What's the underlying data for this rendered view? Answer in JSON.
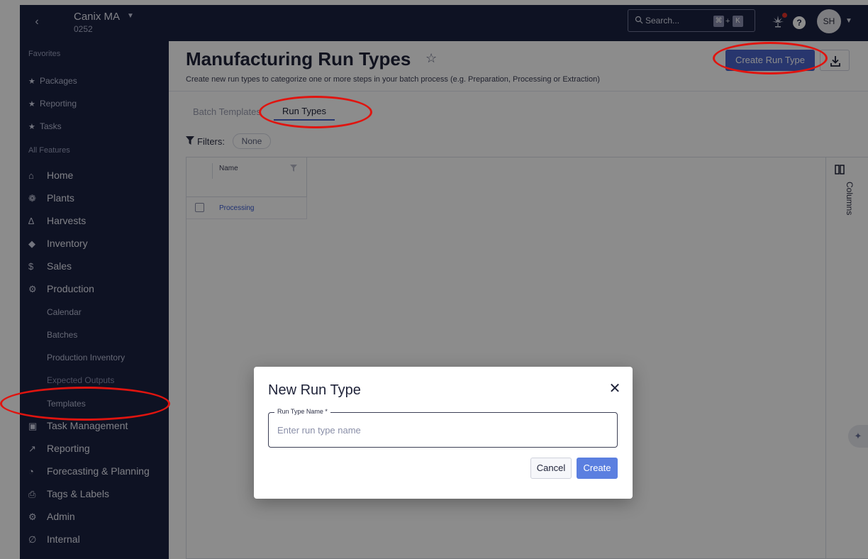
{
  "topbar": {
    "back_icon": "chevron-left-icon",
    "org_name": "Canix MA",
    "org_code": "0252",
    "search_placeholder": "Search...",
    "search_shortcut_cmd": "⌘",
    "search_shortcut_plus": "+",
    "search_shortcut_key": "K",
    "help_label": "?",
    "avatar_initials": "SH"
  },
  "sidebar": {
    "favorites_heading": "Favorites",
    "favorites": [
      {
        "label": "Packages",
        "icon": "star-icon"
      },
      {
        "label": "Reporting",
        "icon": "star-icon"
      },
      {
        "label": "Tasks",
        "icon": "star-icon"
      }
    ],
    "all_features_heading": "All Features",
    "items": [
      {
        "label": "Home",
        "icon": "home-icon"
      },
      {
        "label": "Plants",
        "icon": "plant-icon"
      },
      {
        "label": "Harvests",
        "icon": "harvest-icon"
      },
      {
        "label": "Inventory",
        "icon": "inventory-icon"
      },
      {
        "label": "Sales",
        "icon": "dollar-icon"
      },
      {
        "label": "Production",
        "icon": "production-icon"
      }
    ],
    "production_subitems": [
      "Calendar",
      "Batches",
      "Production Inventory",
      "Expected Outputs",
      "Templates"
    ],
    "items_after": [
      {
        "label": "Task Management",
        "icon": "clipboard-icon"
      },
      {
        "label": "Reporting",
        "icon": "trend-icon"
      },
      {
        "label": "Forecasting & Planning",
        "icon": "pie-icon"
      },
      {
        "label": "Tags & Labels",
        "icon": "printer-icon"
      },
      {
        "label": "Admin",
        "icon": "gear-icon"
      },
      {
        "label": "Internal",
        "icon": "internal-icon"
      }
    ]
  },
  "page": {
    "title": "Manufacturing Run Types",
    "subtitle": "Create new run types to categorize one or more steps in your batch process (e.g. Preparation, Processing or Extraction)",
    "create_button": "Create Run Type",
    "tabs": [
      "Batch Templates",
      "Run Types"
    ],
    "active_tab": "Run Types",
    "filters_label": "Filters:",
    "filters_value": "None",
    "grid": {
      "columns": [
        "Name"
      ],
      "rows": [
        {
          "name": "Processing"
        }
      ]
    },
    "columns_panel_label": "Columns"
  },
  "modal": {
    "title": "New Run Type",
    "field_label": "Run Type Name *",
    "field_placeholder": "Enter run type name",
    "field_value": "",
    "cancel_label": "Cancel",
    "create_label": "Create"
  },
  "colors": {
    "sidebar_bg": "#1b2140",
    "primary": "#4a63c9",
    "annotation": "#e0140f"
  }
}
